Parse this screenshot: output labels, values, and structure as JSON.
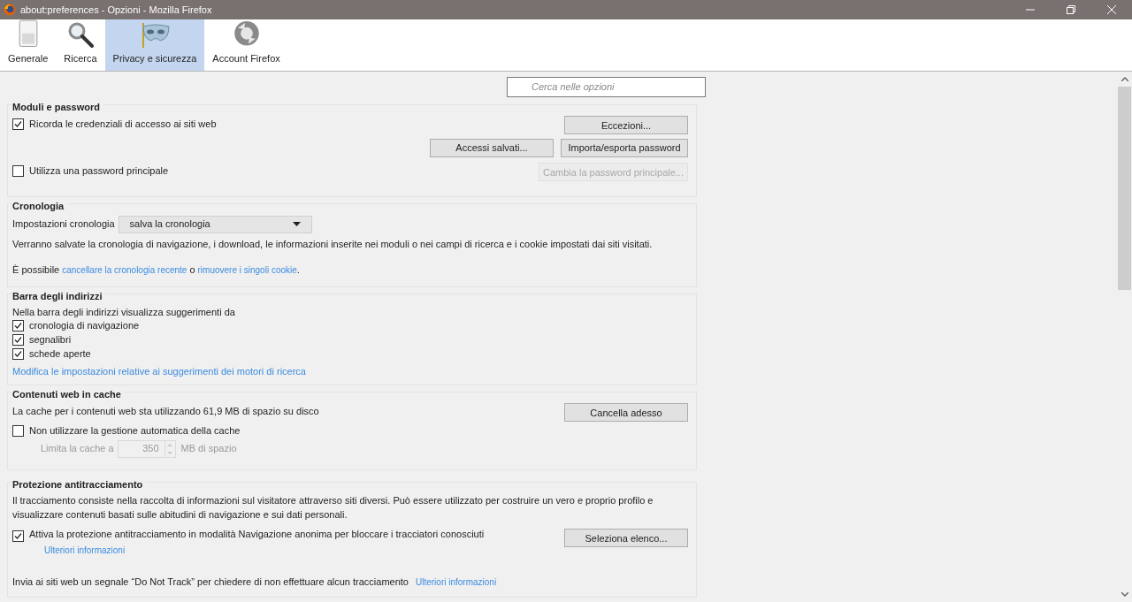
{
  "window": {
    "title": "about:preferences - Opzioni - Mozilla Firefox"
  },
  "tabs": [
    {
      "label": "Generale",
      "kind": "general",
      "selected": false
    },
    {
      "label": "Ricerca",
      "kind": "search",
      "selected": false
    },
    {
      "label": "Privacy e sicurezza",
      "kind": "privacy",
      "selected": true
    },
    {
      "label": "Account Firefox",
      "kind": "sync",
      "selected": false
    }
  ],
  "search": {
    "placeholder": "Cerca nelle opzioni"
  },
  "forms_passwords": {
    "title": "Moduli e password",
    "remember": {
      "label": "Ricorda le credenziali di accesso ai siti web",
      "checked": true
    },
    "exceptions_button": "Eccezioni...",
    "saved_logins_button": "Accessi salvati...",
    "import_export_button": "Importa/esporta password",
    "master": {
      "label": "Utilizza una password principale",
      "checked": false
    },
    "change_master_button": {
      "label": "Cambia la password principale...",
      "disabled": true
    }
  },
  "history": {
    "title": "Cronologia",
    "setting_label": "Impostazioni cronologia",
    "setting_value": "salva la cronologia",
    "description": "Verranno salvate la cronologia di navigazione, i download, le informazioni inserite nei moduli o nei campi di ricerca e i cookie impostati dai siti visitati.",
    "prefix": "È possibile",
    "link_1": "cancellare la cronologia recente",
    "separator": "o",
    "link_2": "rimuovere i singoli cookie",
    "suffix": "."
  },
  "address_bar": {
    "title": "Barra degli indirizzi",
    "intro": "Nella barra degli indirizzi visualizza suggerimenti da",
    "options": [
      {
        "label": "cronologia di navigazione",
        "checked": true
      },
      {
        "label": "segnalibri",
        "checked": true
      },
      {
        "label": "schede aperte",
        "checked": true
      }
    ],
    "link": "Modifica le impostazioni relative ai suggerimenti dei motori di ricerca"
  },
  "cache": {
    "title": "Contenuti web in cache",
    "usage": "La cache per i contenuti web sta utilizzando 61,9 MB di spazio su disco",
    "clear_button": "Cancella adesso",
    "override": {
      "label": "Non utilizzare la gestione automatica della cache",
      "checked": false
    },
    "limit_label": "Limita la cache a",
    "limit_value": "350",
    "limit_unit": "MB di spazio",
    "limit_disabled": true
  },
  "tracking": {
    "title": "Protezione antitracciamento",
    "description": "Il tracciamento consiste nella raccolta di informazioni sul visitatore attraverso siti diversi. Può essere utilizzato per costruire un vero e proprio profilo e visualizzare contenuti basati sulle abitudini di navigazione e sui dati personali.",
    "private": {
      "label": "Attiva la protezione antitracciamento in modalità Navigazione anonima per bloccare i tracciatori conosciuti",
      "checked": true
    },
    "learn_more": "Ulteriori informazioni",
    "block_list_button": "Seleziona elenco...",
    "dnt_text": "Invia ai siti web un segnale “Do Not Track” per chiedere di non effettuare alcun tracciamento",
    "dnt_link": "Ulteriori informazioni"
  }
}
